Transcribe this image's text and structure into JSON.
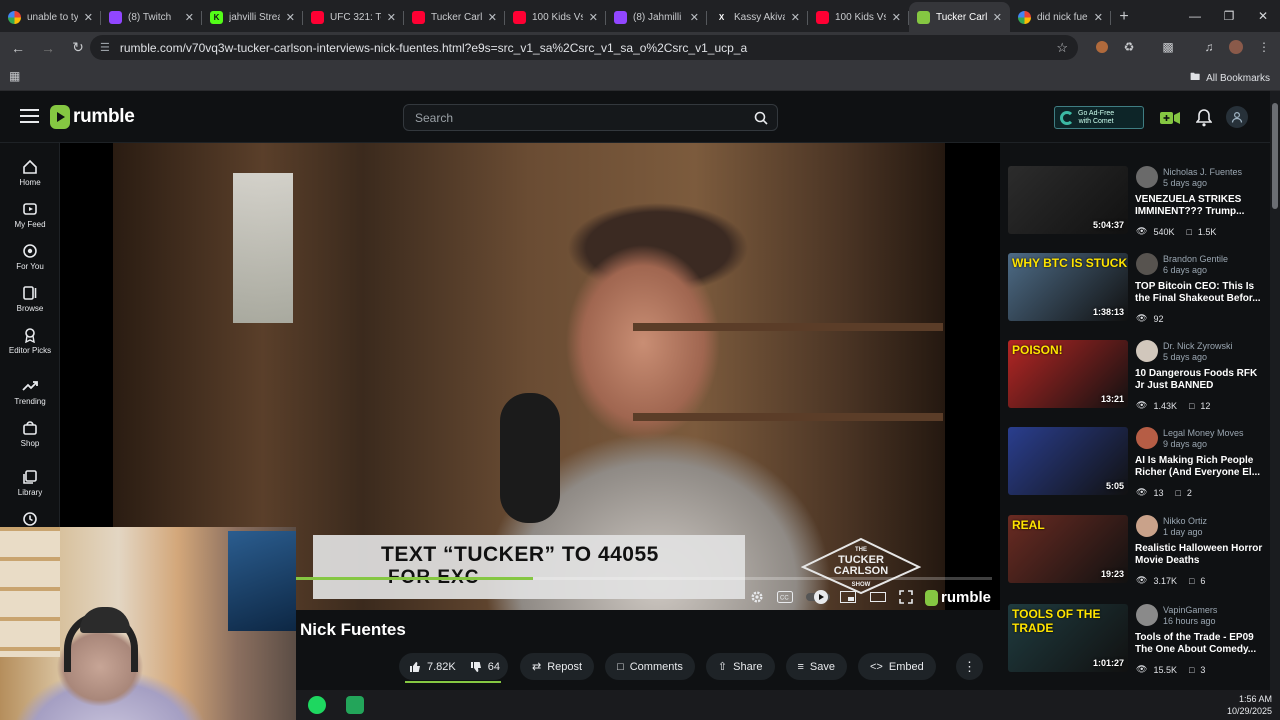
{
  "browser": {
    "tabs": [
      {
        "title": "unable to ty",
        "fav": "google",
        "color": "#ffffff",
        "active": false
      },
      {
        "title": "(8) Twitch",
        "fav": "twitch",
        "color": "#9146ff",
        "active": false
      },
      {
        "title": "jahvilli Strea",
        "fav": "kick",
        "color": "#53fc18",
        "active": false
      },
      {
        "title": "UFC 321: To",
        "fav": "youtube",
        "color": "#ff0033",
        "active": false
      },
      {
        "title": "Tucker Carl",
        "fav": "youtube",
        "color": "#ff0033",
        "active": false
      },
      {
        "title": "100 Kids Vs",
        "fav": "youtube",
        "color": "#ff0033",
        "active": false
      },
      {
        "title": "(8) Jahmilli",
        "fav": "twitch",
        "color": "#9146ff",
        "active": false
      },
      {
        "title": "Kassy Akiva",
        "fav": "x",
        "color": "#ffffff",
        "active": false
      },
      {
        "title": "100 Kids Vs",
        "fav": "youtube",
        "color": "#ff0033",
        "active": false
      },
      {
        "title": "Tucker Carl",
        "fav": "rumble",
        "color": "#85c742",
        "active": true
      },
      {
        "title": "did nick fue",
        "fav": "google",
        "color": "#ffffff",
        "active": false
      }
    ],
    "url": "rumble.com/v70vq3w-tucker-carlson-interviews-nick-fuentes.html?e9s=src_v1_sa%2Csrc_v1_sa_o%2Csrc_v1_ucp_a",
    "all_bookmarks": "All Bookmarks"
  },
  "header": {
    "logo": "rumble",
    "search_placeholder": "Search",
    "adfree_line1": "Go Ad-Free",
    "adfree_line2": "with Comet"
  },
  "sidebar": {
    "items": [
      {
        "label": "Home",
        "icon": "home-icon"
      },
      {
        "label": "My Feed",
        "icon": "feed-icon"
      },
      {
        "label": "For You",
        "icon": "for-you-icon"
      },
      {
        "label": "Browse",
        "icon": "browse-icon"
      },
      {
        "label": "Editor Picks",
        "icon": "editor-picks-icon"
      },
      {
        "label": "Trending",
        "icon": "trending-icon"
      },
      {
        "label": "Shop",
        "icon": "shop-icon"
      },
      {
        "label": "Library",
        "icon": "library-icon"
      }
    ]
  },
  "video": {
    "lower_third_line1": "TEXT “TUCKER” TO 44055",
    "lower_third_line2": "FOR EXC",
    "show_logo_top": "THE",
    "show_logo_main": "TUCKER CARLSON",
    "show_logo_bottom": "SHOW",
    "watermark": "rumble",
    "progress": 0.34
  },
  "details": {
    "title": "Nick Fuentes",
    "likes": "7.82K",
    "dislikes": "64",
    "repost": "Repost",
    "comments": "Comments",
    "share": "Share",
    "save": "Save",
    "embed": "Embed"
  },
  "recommendations": [
    {
      "channel": "Nicholas J. Fuentes",
      "ago": "5 days ago",
      "title": "VENEZUELA STRIKES IMMINENT??? Trump...",
      "duration": "5:04:37",
      "views": "540K",
      "comments": "1.5K",
      "thumb_caption": "",
      "thumb_bg": "#2c2c2c",
      "avatar_bg": "#6a6a6a"
    },
    {
      "channel": "Brandon Gentile",
      "ago": "6 days ago",
      "title": "TOP Bitcoin CEO: This Is the Final Shakeout Befor...",
      "duration": "1:38:13",
      "views": "92",
      "comments": "",
      "thumb_caption": "WHY BTC IS STUCK",
      "thumb_bg": "#4d6b86",
      "avatar_bg": "#57534f"
    },
    {
      "channel": "Dr. Nick Zyrowski",
      "ago": "5 days ago",
      "title": "10 Dangerous Foods RFK Jr Just BANNED",
      "duration": "13:21",
      "views": "1.43K",
      "comments": "12",
      "thumb_caption": "POISON!",
      "thumb_bg": "#b32624",
      "avatar_bg": "#d1c7bc"
    },
    {
      "channel": "Legal Money Moves",
      "ago": "9 days ago",
      "title": "AI Is Making Rich People Richer (And Everyone El...",
      "duration": "5:05",
      "views": "13",
      "comments": "2",
      "thumb_caption": "",
      "thumb_bg": "#2a3e8e",
      "avatar_bg": "#b65d45"
    },
    {
      "channel": "Nikko Ortiz",
      "ago": "1 day ago",
      "title": "Realistic Halloween Horror Movie Deaths",
      "duration": "19:23",
      "views": "3.17K",
      "comments": "6",
      "thumb_caption": "REAL",
      "thumb_bg": "#6a2b22",
      "avatar_bg": "#c9a28a"
    },
    {
      "channel": "VapinGamers",
      "ago": "16 hours ago",
      "title": "Tools of the Trade - EP09 The One About Comedy...",
      "duration": "1:01:27",
      "views": "15.5K",
      "comments": "3",
      "thumb_caption": "TOOLS OF THE TRADE",
      "thumb_bg": "#1f3b3f",
      "avatar_bg": "#8a8a8a"
    }
  ],
  "taskbar": {
    "time": "1:56 AM",
    "date": "10/29/2025"
  },
  "colors": {
    "accent": "#85c742",
    "background": "#0f1113"
  }
}
